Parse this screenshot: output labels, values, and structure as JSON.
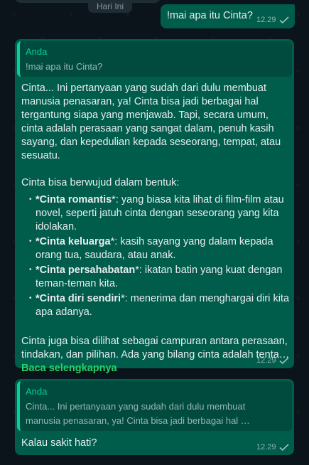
{
  "date_chip": "Hari Ini",
  "messages": {
    "question": {
      "text": "!mai apa itu Cinta?",
      "time": "12.29"
    },
    "answer": {
      "reply_author": "Anda",
      "reply_quote": "!mai apa itu Cinta?",
      "para1": "Cinta... Ini pertanyaan yang sudah dari dulu membuat manusia penasaran, ya! Cinta bisa jadi berbagai hal tergantung siapa yang menjawab. Tapi, secara umum, cinta adalah perasaan yang sangat dalam, penuh kasih sayang, dan kepedulian kepada seseorang, tempat, atau sesuatu.",
      "para2": "Cinta bisa berwujud dalam bentuk:",
      "bullets": [
        {
          "bold": "*Cinta romantis",
          "rest": "*: yang biasa kita lihat di film-film atau novel, seperti jatuh cinta dengan seseorang yang kita idolakan."
        },
        {
          "bold": "*Cinta keluarga",
          "rest": "*: kasih sayang yang dalam kepada orang tua, saudara, atau anak."
        },
        {
          "bold": "*Cinta persahabatan",
          "rest": "*: ikatan batin yang kuat dengan teman-teman kita."
        },
        {
          "bold": "*Cinta diri sendiri",
          "rest": "*: menerima dan menghargai diri kita apa adanya."
        }
      ],
      "para3": "Cinta juga bisa dilihat sebagai campuran antara perasaan, tindakan, dan pilihan. Ada yang bilang cinta adalah tenta…",
      "read_more": "Baca selengkapnya",
      "time": "12.29"
    },
    "followup": {
      "reply_author": "Anda",
      "reply_quote_line1": "Cinta... Ini pertanyaan yang sudah dari dulu membuat",
      "reply_quote_line2": "manusia penasaran, ya! Cinta bisa jadi berbagai hal …",
      "text": "Kalau sakit hati?",
      "time": "12.29"
    }
  },
  "colors": {
    "background": "#0b141a",
    "bubble": "#005c4b",
    "accent": "#06cf9c",
    "read_more": "#25d366"
  },
  "icons": [
    "check-icon"
  ]
}
